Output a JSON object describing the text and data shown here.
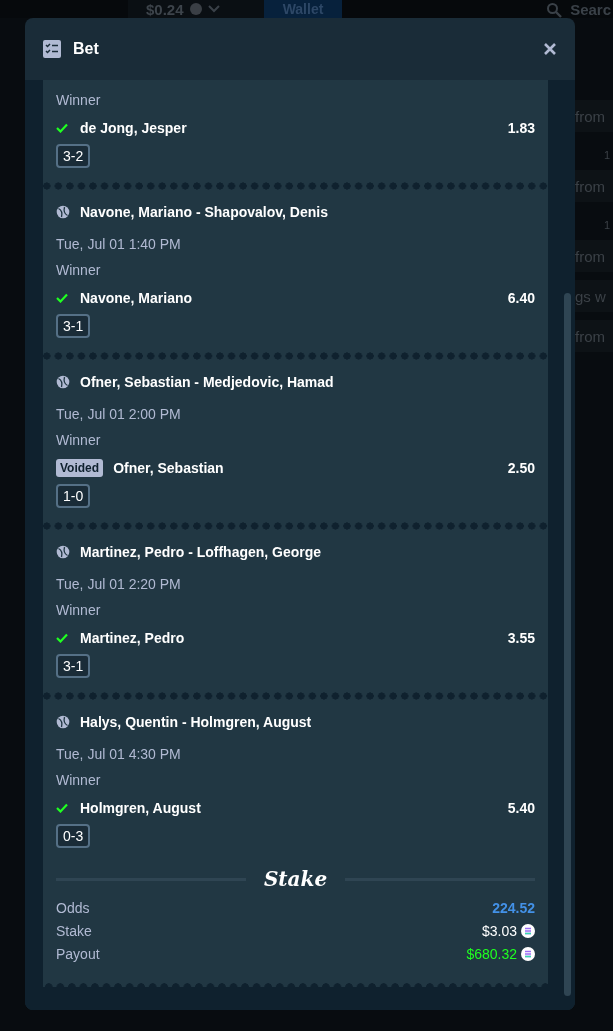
{
  "background": {
    "balance": "$0.24",
    "wallet_button": "Wallet",
    "search_label": "Searc",
    "fragments": [
      {
        "text": "from",
        "kind": "line"
      },
      {
        "text": "1",
        "kind": "small"
      },
      {
        "text": "from",
        "kind": "line"
      },
      {
        "text": "1",
        "kind": "small"
      },
      {
        "text": "from",
        "kind": "line"
      },
      {
        "text": "gs w",
        "kind": "line"
      },
      {
        "text": "from",
        "kind": "line"
      }
    ]
  },
  "modal": {
    "title": "Bet"
  },
  "legs": [
    {
      "market": "Winner",
      "selection": "de Jong, Jesper",
      "won": true,
      "odds": "1.83",
      "score": "3-2"
    },
    {
      "match": "Navone, Mariano - Shapovalov, Denis",
      "date": "Tue, Jul 01 1:40 PM",
      "market": "Winner",
      "selection": "Navone, Mariano",
      "won": true,
      "odds": "6.40",
      "score": "3-1"
    },
    {
      "match": "Ofner, Sebastian - Medjedovic, Hamad",
      "date": "Tue, Jul 01 2:00 PM",
      "market": "Winner",
      "selection": "Ofner, Sebastian",
      "won": false,
      "voided_label": "Voided",
      "odds": "2.50",
      "score": "1-0"
    },
    {
      "match": "Martinez, Pedro - Loffhagen, George",
      "date": "Tue, Jul 01 2:20 PM",
      "market": "Winner",
      "selection": "Martinez, Pedro",
      "won": true,
      "odds": "3.55",
      "score": "3-1"
    },
    {
      "match": "Halys, Quentin - Holmgren, August",
      "date": "Tue, Jul 01 4:30 PM",
      "market": "Winner",
      "selection": "Holmgren, August",
      "won": true,
      "odds": "5.40",
      "score": "0-3"
    }
  ],
  "summary": {
    "logo": "Stake",
    "rows": [
      {
        "label": "Odds",
        "value": "224.52",
        "kind": "odds"
      },
      {
        "label": "Stake",
        "value": "$3.03",
        "kind": "amount"
      },
      {
        "label": "Payout",
        "value": "$680.32",
        "kind": "payout"
      }
    ]
  }
}
